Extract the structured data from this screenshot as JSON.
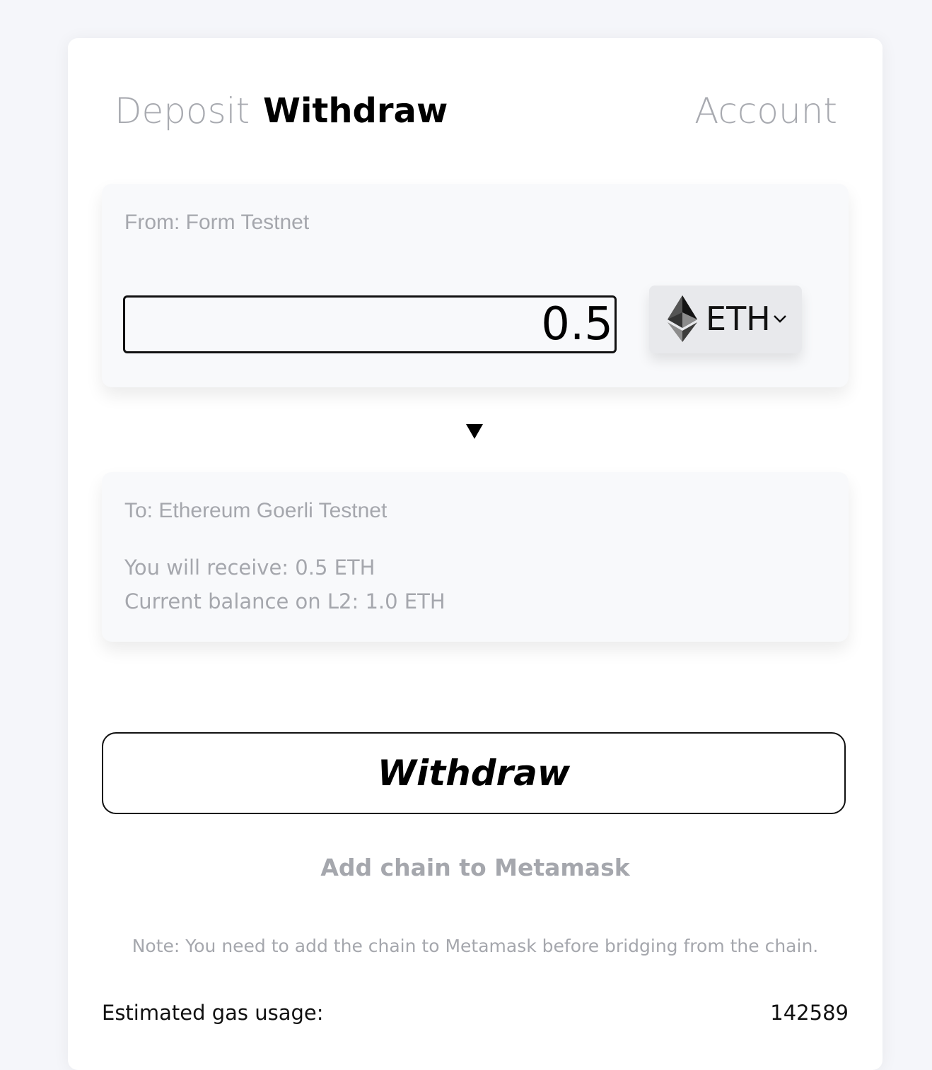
{
  "tabs": {
    "deposit": "Deposit",
    "withdraw": "Withdraw",
    "account": "Account",
    "active": "withdraw"
  },
  "from_panel": {
    "label": "From: Form Testnet",
    "amount": "0.5",
    "token": "ETH",
    "token_icon": "ethereum-icon"
  },
  "direction_icon": "arrow-down-icon",
  "to_panel": {
    "label": "To: Ethereum Goerli Testnet",
    "receive": "You will receive: 0.5 ETH",
    "balance": "Current balance on L2: 1.0 ETH"
  },
  "actions": {
    "withdraw_button": "Withdraw",
    "add_chain_link": "Add chain to Metamask"
  },
  "note": "Note: You need to add the chain to Metamask before bridging from the chain.",
  "gas": {
    "label": "Estimated gas usage:",
    "value": "142589"
  },
  "colors": {
    "background": "#f5f6fa",
    "card": "#ffffff",
    "muted_text": "#a5a7ad",
    "panel": "#f8f9fb",
    "token_button": "#e8e9ec"
  }
}
